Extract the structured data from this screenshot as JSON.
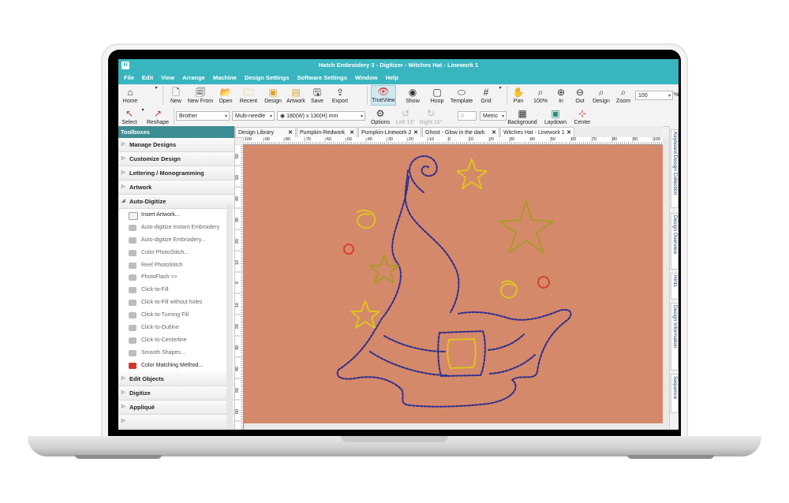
{
  "window": {
    "title": "Hatch Embroidery 3 - Digitizer - Witches Hat - Linework 1",
    "app_icon": "H"
  },
  "menu": [
    "File",
    "Edit",
    "View",
    "Arrange",
    "Machine",
    "Design Settings",
    "Software Settings",
    "Window",
    "Help"
  ],
  "toolbar1": {
    "home": "Home",
    "new": "New",
    "new_from": "New From",
    "open": "Open",
    "recent": "Recent",
    "design": "Design",
    "artwork": "Artwork",
    "save": "Save",
    "export": "Export",
    "trueview": "TrueView",
    "show": "Show",
    "hoop": "Hoop",
    "template": "Template",
    "grid": "Grid",
    "pan": "Pan",
    "zoom100": "100%",
    "zoom_in": "In",
    "zoom_out": "Out",
    "zoom_design": "Design",
    "zoom": "Zoom",
    "zoom_value": "100",
    "zoom_unit": "%"
  },
  "toolbar2": {
    "select": "Select",
    "reshape": "Reshape",
    "machine": "Brother",
    "machine_type": "Multi-needle",
    "hoop_size": "180(W) x 130(H) mm",
    "options": "Options",
    "left": "Left 15°",
    "right": "Right 15°",
    "angle": "0",
    "units": "Metric",
    "background": "Background",
    "laydown": "Laydown",
    "center": "Center"
  },
  "toolboxes": {
    "header": "Toolboxes",
    "sections_top": [
      "Manage Designs",
      "Customize Design",
      "Lettering / Monogramming",
      "Artwork"
    ],
    "auto_digitize": "Auto-Digitize",
    "items": [
      "Insert Artwork...",
      "Auto-digitize Instant Embroidery",
      "Auto-digitize Embroidery...",
      "Color PhotoStitch...",
      "Reef PhotoStitch",
      "PhotoFlash >>",
      "Click-to-Fill",
      "Click-to-Fill without holes",
      "Click-to-Turning Fill",
      "Click-to-Outline",
      "Click-to-Centerline",
      "Smooth Shapes...",
      "Color Matching Method..."
    ],
    "sections_bottom": [
      "Edit Objects",
      "Digitize",
      "Appliqué"
    ]
  },
  "tabs": [
    "Design Library",
    "Pumpkin-Redwork",
    "Pumpkin-Linework 2",
    "Ghost - Glow in the dark",
    "Witches Hat - Linework 1"
  ],
  "ruler_h": [
    "-100",
    "-90",
    "-80",
    "-70",
    "-60",
    "-50",
    "-40",
    "-30",
    "-20",
    "-10",
    "0",
    "10",
    "20",
    "30",
    "40",
    "50",
    "60",
    "70",
    "80",
    "90",
    "100"
  ],
  "ruler_v": [
    "60",
    "50",
    "40",
    "30",
    "20",
    "10",
    "0",
    "10",
    "20",
    "30",
    "40",
    "50",
    "60"
  ],
  "side_tabs": [
    "Keyboard Design Collection",
    "Design Overview",
    "Hints",
    "Design Information",
    "Sequence"
  ],
  "colors": {
    "accent": "#39b5c0",
    "canvas": "#d4896a",
    "thread_hat": "#2f2d8f",
    "thread_gold": "#e0c61a",
    "thread_red": "#d93a2a",
    "thread_olive": "#a89b22"
  }
}
